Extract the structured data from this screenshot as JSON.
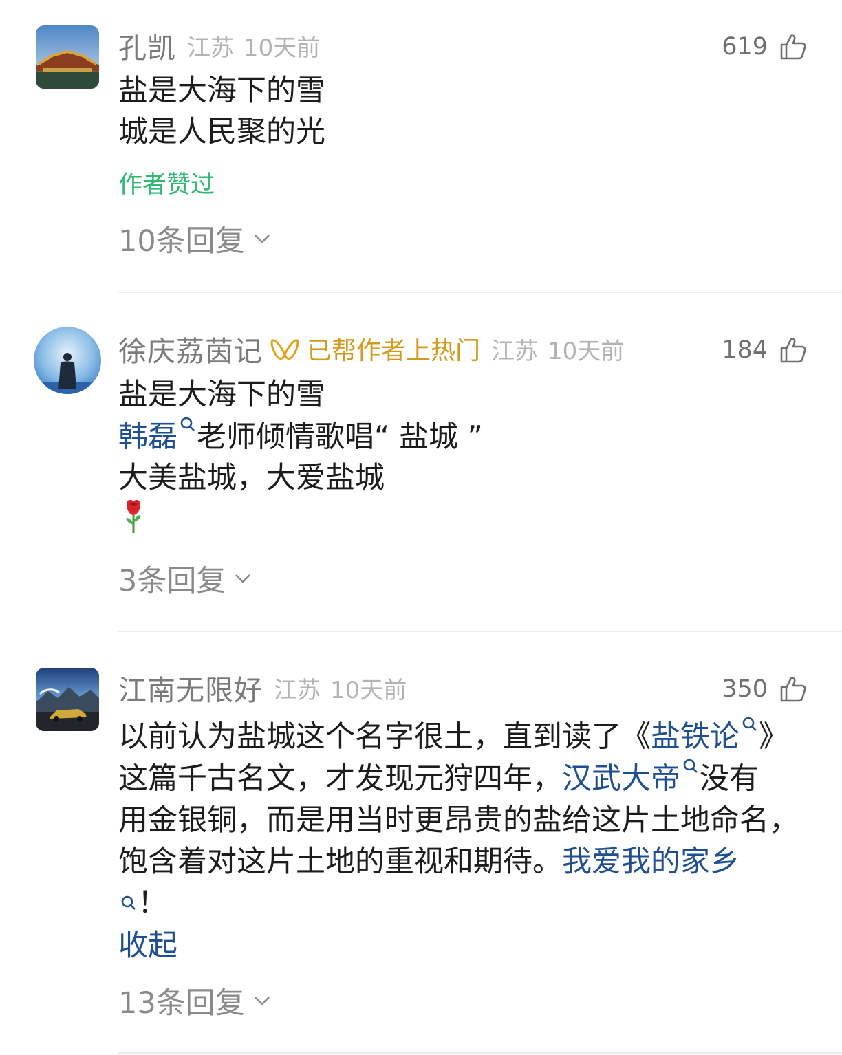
{
  "comments": [
    {
      "username": "孔凯",
      "location": "江苏",
      "time": "10天前",
      "likes": "619",
      "lines": [
        "盐是大海下的雪",
        "城是人民聚的光"
      ],
      "tag": "作者赞过",
      "replies": "10条回复"
    },
    {
      "username": "徐庆荔茵记",
      "badge": "已帮作者上热门",
      "location": "江苏",
      "time": "10天前",
      "likes": "184",
      "line1": "盐是大海下的雪",
      "line2_link": "韩磊",
      "line2_rest": "老师倾情歌唱“ 盐城 ”",
      "line3": "大美盐城，大爱盐城",
      "emoji": "rose",
      "replies": "3条回复"
    },
    {
      "username": "江南无限好",
      "location": "江苏",
      "time": "10天前",
      "likes": "350",
      "p1": "以前认为盐城这个名字很土，直到读了《",
      "link1": "盐铁论",
      "p2": "》",
      "p3": "这篇千古名文，才发现元狩四年，",
      "link2": "汉武大帝",
      "p4": "没有",
      "p5": "用金银铜，而是用当时更昂贵的盐给这片土地命名，",
      "p6": "饱含着对这片土地的重视和期待。",
      "link3": "我爱我的家乡",
      "p7": "！",
      "collapse": "收起",
      "replies": "13条回复"
    }
  ],
  "icons": {
    "like": "thumbs-up-icon",
    "search": "search-icon",
    "chevron": "chevron-down-icon",
    "badge": "hot-badge-icon"
  },
  "colors": {
    "link": "#1d4f91",
    "green_tag": "#2eb872",
    "badge": "#d39a1e",
    "meta": "#b3b3b3"
  }
}
